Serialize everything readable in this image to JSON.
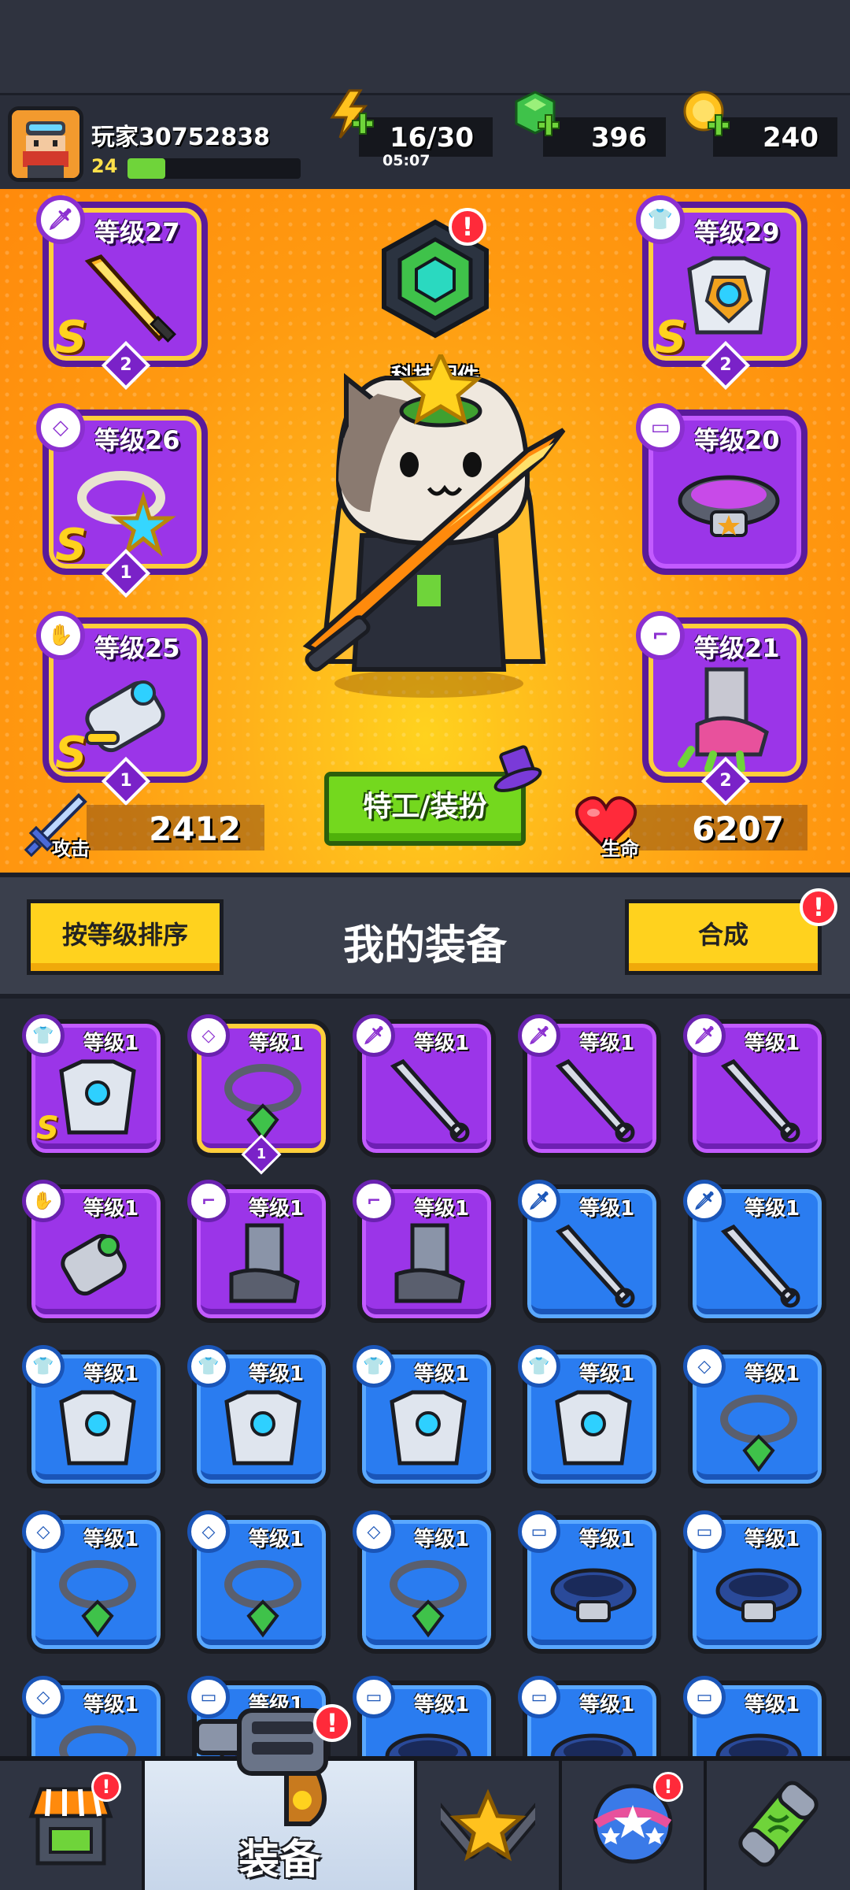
{
  "player": {
    "name": "玩家30752838",
    "level": "24",
    "xp_progress": 0.22
  },
  "resources": {
    "energy": {
      "value": "16/30",
      "timer": "05:07",
      "icon": "lightning-plus-icon"
    },
    "gems": {
      "value": "396",
      "icon": "green-gem-plus-icon"
    },
    "coins": {
      "value": "240",
      "icon": "gold-coin-plus-icon"
    }
  },
  "equipped": {
    "weapon": {
      "level": "等级27",
      "rank": "S",
      "stars": "2",
      "icon": "flame-sword-icon"
    },
    "armor": {
      "level": "等级29",
      "rank": "S",
      "stars": "2",
      "icon": "mech-armor-icon"
    },
    "necklace": {
      "level": "等级26",
      "rank": "S",
      "stars": "1",
      "icon": "star-ring-necklace-icon"
    },
    "belt": {
      "level": "等级20",
      "icon": "star-belt-icon"
    },
    "glove": {
      "level": "等级25",
      "rank": "S",
      "stars": "1",
      "icon": "robot-glove-icon"
    },
    "boots": {
      "level": "等级21",
      "stars": "2",
      "icon": "claw-boots-icon"
    }
  },
  "tech_part": {
    "label": "科技配件",
    "alert": "!"
  },
  "agent_button": "特工/装扮",
  "stats": {
    "attack": {
      "label": "攻击",
      "value": "2412"
    },
    "health": {
      "label": "生命",
      "value": "6207"
    }
  },
  "midbar": {
    "sort_button": "按等级排序",
    "title": "我的装备",
    "merge_button": "合成",
    "merge_alert": "!"
  },
  "inventory": [
    {
      "level": "等级1",
      "rarity": "purple",
      "slot": "armor",
      "icon": "mech-armor-icon",
      "rank": "S"
    },
    {
      "level": "等级1",
      "rarity": "purple",
      "slot": "necklace",
      "icon": "emerald-necklace-icon",
      "stars": "1",
      "gold": true
    },
    {
      "level": "等级1",
      "rarity": "purple",
      "slot": "weapon",
      "icon": "kunai-icon"
    },
    {
      "level": "等级1",
      "rarity": "purple",
      "slot": "weapon",
      "icon": "machete-icon"
    },
    {
      "level": "等级1",
      "rarity": "purple",
      "slot": "weapon",
      "icon": "spiked-club-icon"
    },
    {
      "level": "等级1",
      "rarity": "purple",
      "slot": "glove",
      "icon": "tech-glove-icon"
    },
    {
      "level": "等级1",
      "rarity": "purple",
      "slot": "boots",
      "icon": "steel-boots-icon"
    },
    {
      "level": "等级1",
      "rarity": "purple",
      "slot": "boots",
      "icon": "sneaker-boots-icon"
    },
    {
      "level": "等级1",
      "rarity": "blue",
      "slot": "weapon",
      "icon": "kunai-icon"
    },
    {
      "level": "等级1",
      "rarity": "blue",
      "slot": "weapon",
      "icon": "revolver-icon"
    },
    {
      "level": "等级1",
      "rarity": "blue",
      "slot": "armor",
      "icon": "leather-jacket-icon"
    },
    {
      "level": "等级1",
      "rarity": "blue",
      "slot": "armor",
      "icon": "steel-vest-icon"
    },
    {
      "level": "等级1",
      "rarity": "blue",
      "slot": "armor",
      "icon": "blue-armor-icon"
    },
    {
      "level": "等级1",
      "rarity": "blue",
      "slot": "armor",
      "icon": "camo-shirt-icon"
    },
    {
      "level": "等级1",
      "rarity": "blue",
      "slot": "necklace",
      "icon": "tooth-necklace-icon"
    },
    {
      "level": "等级1",
      "rarity": "blue",
      "slot": "necklace",
      "icon": "lightning-necklace-icon"
    },
    {
      "level": "等级1",
      "rarity": "blue",
      "slot": "necklace",
      "icon": "green-gem-necklace-icon"
    },
    {
      "level": "等级1",
      "rarity": "blue",
      "slot": "necklace",
      "icon": "green-gem-necklace-icon"
    },
    {
      "level": "等级1",
      "rarity": "blue",
      "slot": "belt",
      "icon": "blue-belt-icon"
    },
    {
      "level": "等级1",
      "rarity": "blue",
      "slot": "belt",
      "icon": "blue-belt-icon"
    },
    {
      "level": "等级1",
      "rarity": "blue",
      "slot": "necklace",
      "icon": "rope-necklace-icon"
    },
    {
      "level": "等级1",
      "rarity": "blue",
      "slot": "belt",
      "icon": "belt-icon"
    },
    {
      "level": "等级1",
      "rarity": "blue",
      "slot": "belt",
      "icon": "red-belt-icon"
    },
    {
      "level": "等级1",
      "rarity": "blue",
      "slot": "belt",
      "icon": "belt-icon"
    },
    {
      "level": "等级1",
      "rarity": "blue",
      "slot": "belt",
      "icon": "belt-icon"
    }
  ],
  "nav": [
    {
      "id": "shop",
      "icon": "shop-icon",
      "alert": "!"
    },
    {
      "id": "equipment",
      "label": "装备",
      "icon": "revolver-icon",
      "alert": "!",
      "active": true
    },
    {
      "id": "battle",
      "icon": "crossed-swords-star-icon"
    },
    {
      "id": "talent",
      "icon": "star-ball-icon",
      "alert": "!"
    },
    {
      "id": "lab",
      "icon": "dna-capsule-icon"
    }
  ],
  "colors": {
    "orange": "#ff9a10",
    "purple": "#9b35e8",
    "blue": "#2a7cf0",
    "green": "#74d81e",
    "yellow": "#ffd21e"
  }
}
